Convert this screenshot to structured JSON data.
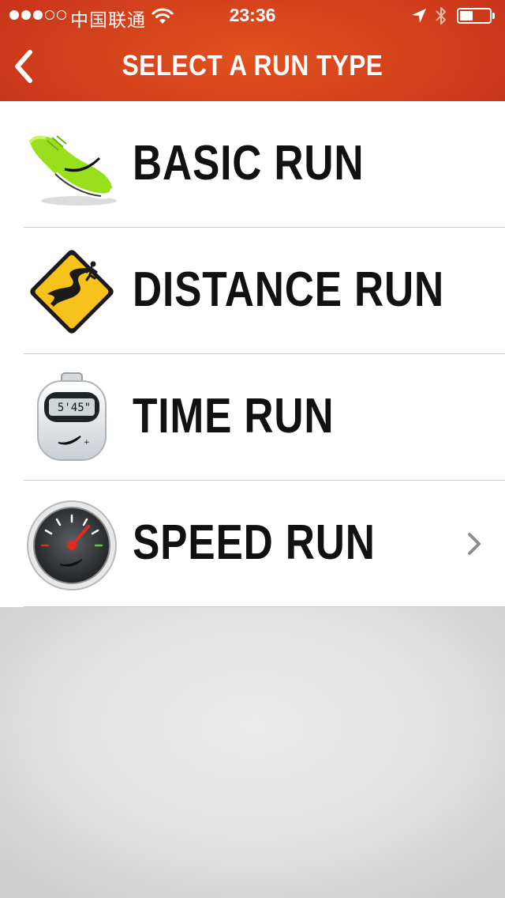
{
  "status_bar": {
    "carrier": "中国联通",
    "time": "23:36",
    "signal_bars_filled": 3,
    "signal_bars_total": 5,
    "battery_level": 0.45
  },
  "nav": {
    "title": "SELECT A RUN TYPE",
    "back_icon": "chevron-left-icon"
  },
  "run_types": [
    {
      "label": "BASIC RUN",
      "icon": "running-shoe-icon"
    },
    {
      "label": "DISTANCE RUN",
      "icon": "road-sign-icon"
    },
    {
      "label": "TIME RUN",
      "icon": "stopwatch-icon",
      "stopwatch_readout": "5'45\""
    },
    {
      "label": "SPEED RUN",
      "icon": "speedometer-icon",
      "chevron_icon": "chevron-right-icon"
    }
  ],
  "colors": {
    "header_accent": "#d4421c",
    "shoe_green": "#9adf1c",
    "road_sign_yellow": "#f6c21b",
    "text": "#111111"
  }
}
